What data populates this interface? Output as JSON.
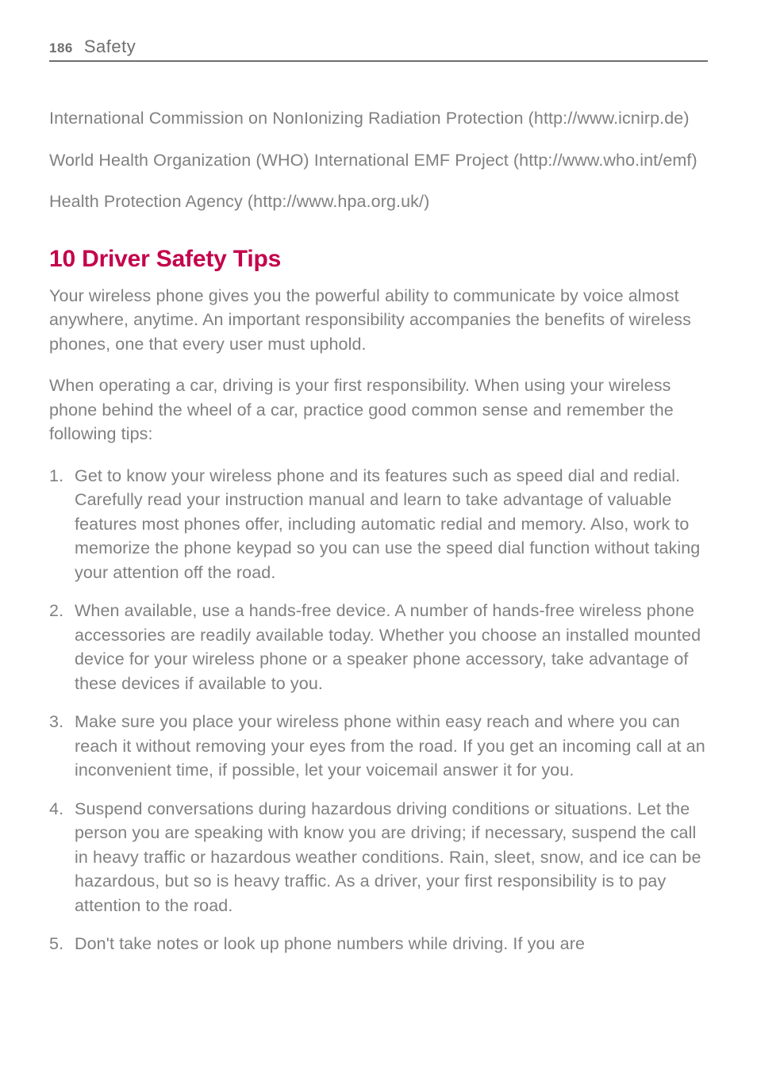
{
  "header": {
    "page_number": "186",
    "section_title": "Safety"
  },
  "intro_paragraphs": [
    "International Commission on NonIonizing Radiation Protection (http://www.icnirp.de)",
    "World Health Organization (WHO) International EMF Project (http://www.who.int/emf)",
    "Health Protection Agency (http://www.hpa.org.uk/)"
  ],
  "heading": "10 Driver Safety Tips",
  "body_paragraphs": [
    "Your wireless phone gives you the powerful ability to communicate by voice almost anywhere, anytime. An important responsibility accompanies the benefits of wireless phones, one that every user must uphold.",
    "When operating a car, driving is your first responsibility. When using your wireless phone behind the wheel of a car, practice good common sense and remember the following tips:"
  ],
  "tips": [
    "Get to know your wireless phone and its features such as speed dial and redial. Carefully read your instruction manual and learn to take advantage of valuable features most phones offer, including automatic redial and memory. Also, work to memorize the phone keypad so you can use the speed dial function without taking your attention off the road.",
    "When available, use a hands-free device. A number of hands-free wireless phone accessories are readily available today. Whether you choose an installed mounted device for your wireless phone or a speaker phone accessory, take advantage of these devices if available to you.",
    "Make sure you place your wireless phone within easy reach and where you can reach it without removing your eyes from the road. If you get an incoming call at an inconvenient time, if possible, let your voicemail answer it for you.",
    "Suspend conversations during hazardous driving conditions or situations. Let the person you are speaking with know you are driving; if necessary, suspend the call in heavy traffic or hazardous weather conditions. Rain, sleet, snow, and ice can be hazardous, but so is heavy traffic. As a driver, your first responsibility is to pay attention to the road.",
    "Don't take notes or look up phone numbers while driving. If you are"
  ]
}
